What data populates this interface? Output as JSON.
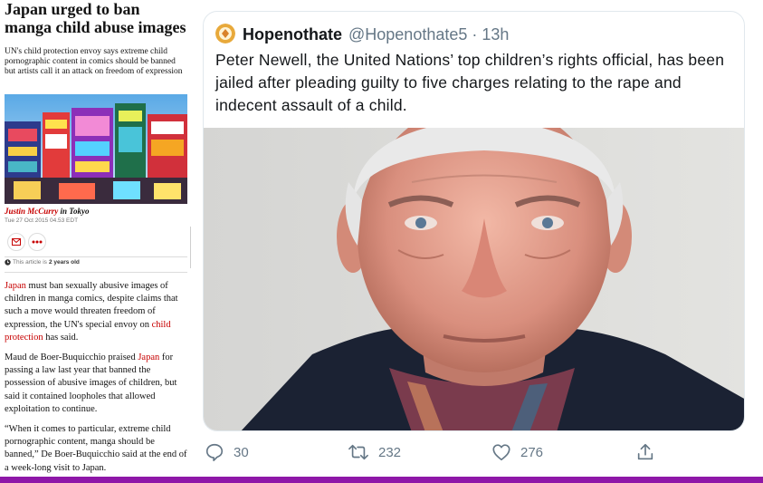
{
  "article": {
    "headline": "Japan urged to ban manga child abuse images",
    "standfirst": "UN's child protection envoy says extreme child pornographic content in comics should be banned but artists call it an attack on freedom of expression",
    "byline_name": "Justin McCurry",
    "byline_loc": "in Tokyo",
    "dateline": "Tue 27 Oct 2015 04.53 EDT",
    "age_prefix": "This article is",
    "age_value": "2 years old",
    "paragraphs": [
      {
        "link1": "Japan",
        "text1": " must ban sexually abusive images of children in manga comics, despite claims that such a move would threaten freedom of expression, the UN's special envoy on ",
        "link2": "child protection",
        "text2": " has said."
      },
      {
        "text1": "Maud de Boer-Buquicchio praised ",
        "link1": "Japan",
        "text2": " for passing a law last year that banned the possession of abusive images of children, but said it contained loopholes that allowed exploitation to continue."
      },
      {
        "text1": "“When it comes to particular, extreme child pornographic content, manga should be banned,” De Boer-Buquicchio said at the end of a week-long visit to Japan."
      }
    ]
  },
  "tweet": {
    "display_name": "Hopenothate",
    "handle_time": "@Hopenothate5 · 13h",
    "text": "Peter Newell, the United Nations’ top children’s rights official, has been jailed after pleading guilty to five charges relating to the rape and indecent assault of a child.",
    "actions": {
      "reply_count": "30",
      "retweet_count": "232",
      "like_count": "276"
    }
  },
  "colors": {
    "accent_red": "#c70000",
    "twitter_gray": "#657786",
    "bottom_bar": "#8e17a8"
  },
  "icons": [
    "mail-icon",
    "more-icon",
    "clock-icon",
    "reply-icon",
    "retweet-icon",
    "like-icon",
    "share-icon"
  ]
}
